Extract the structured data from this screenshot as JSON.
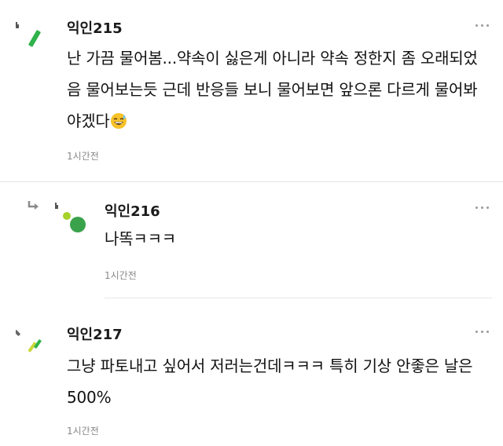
{
  "comments": [
    {
      "nickname": "익인215",
      "text_before_emoji": "난 가끔 물어봄...약속이 싫은게 아니라 약속 정한지 좀 오래되었음 물어보는듯 근데 반응들 보니 물어보면 앞으론 다르게 물어봐야겠다",
      "emoji": "grinning-sweat-emoji",
      "time": "1시간전"
    },
    {
      "nickname": "익인216",
      "text": "나똑ㅋㅋㅋ",
      "time": "1시간전",
      "is_reply": true,
      "reply_icon": "reply-arrow-icon"
    },
    {
      "nickname": "익인217",
      "text": "그냥 파토내고 싶어서 저러는건데ㅋㅋㅋ 특히 기상 안좋은 날은 500%",
      "time": "1시간전"
    }
  ],
  "icons": {
    "more": "more-options-icon",
    "avatar_colors": [
      "#2fb24a",
      "#a6d22a",
      "#3aa24a"
    ]
  }
}
